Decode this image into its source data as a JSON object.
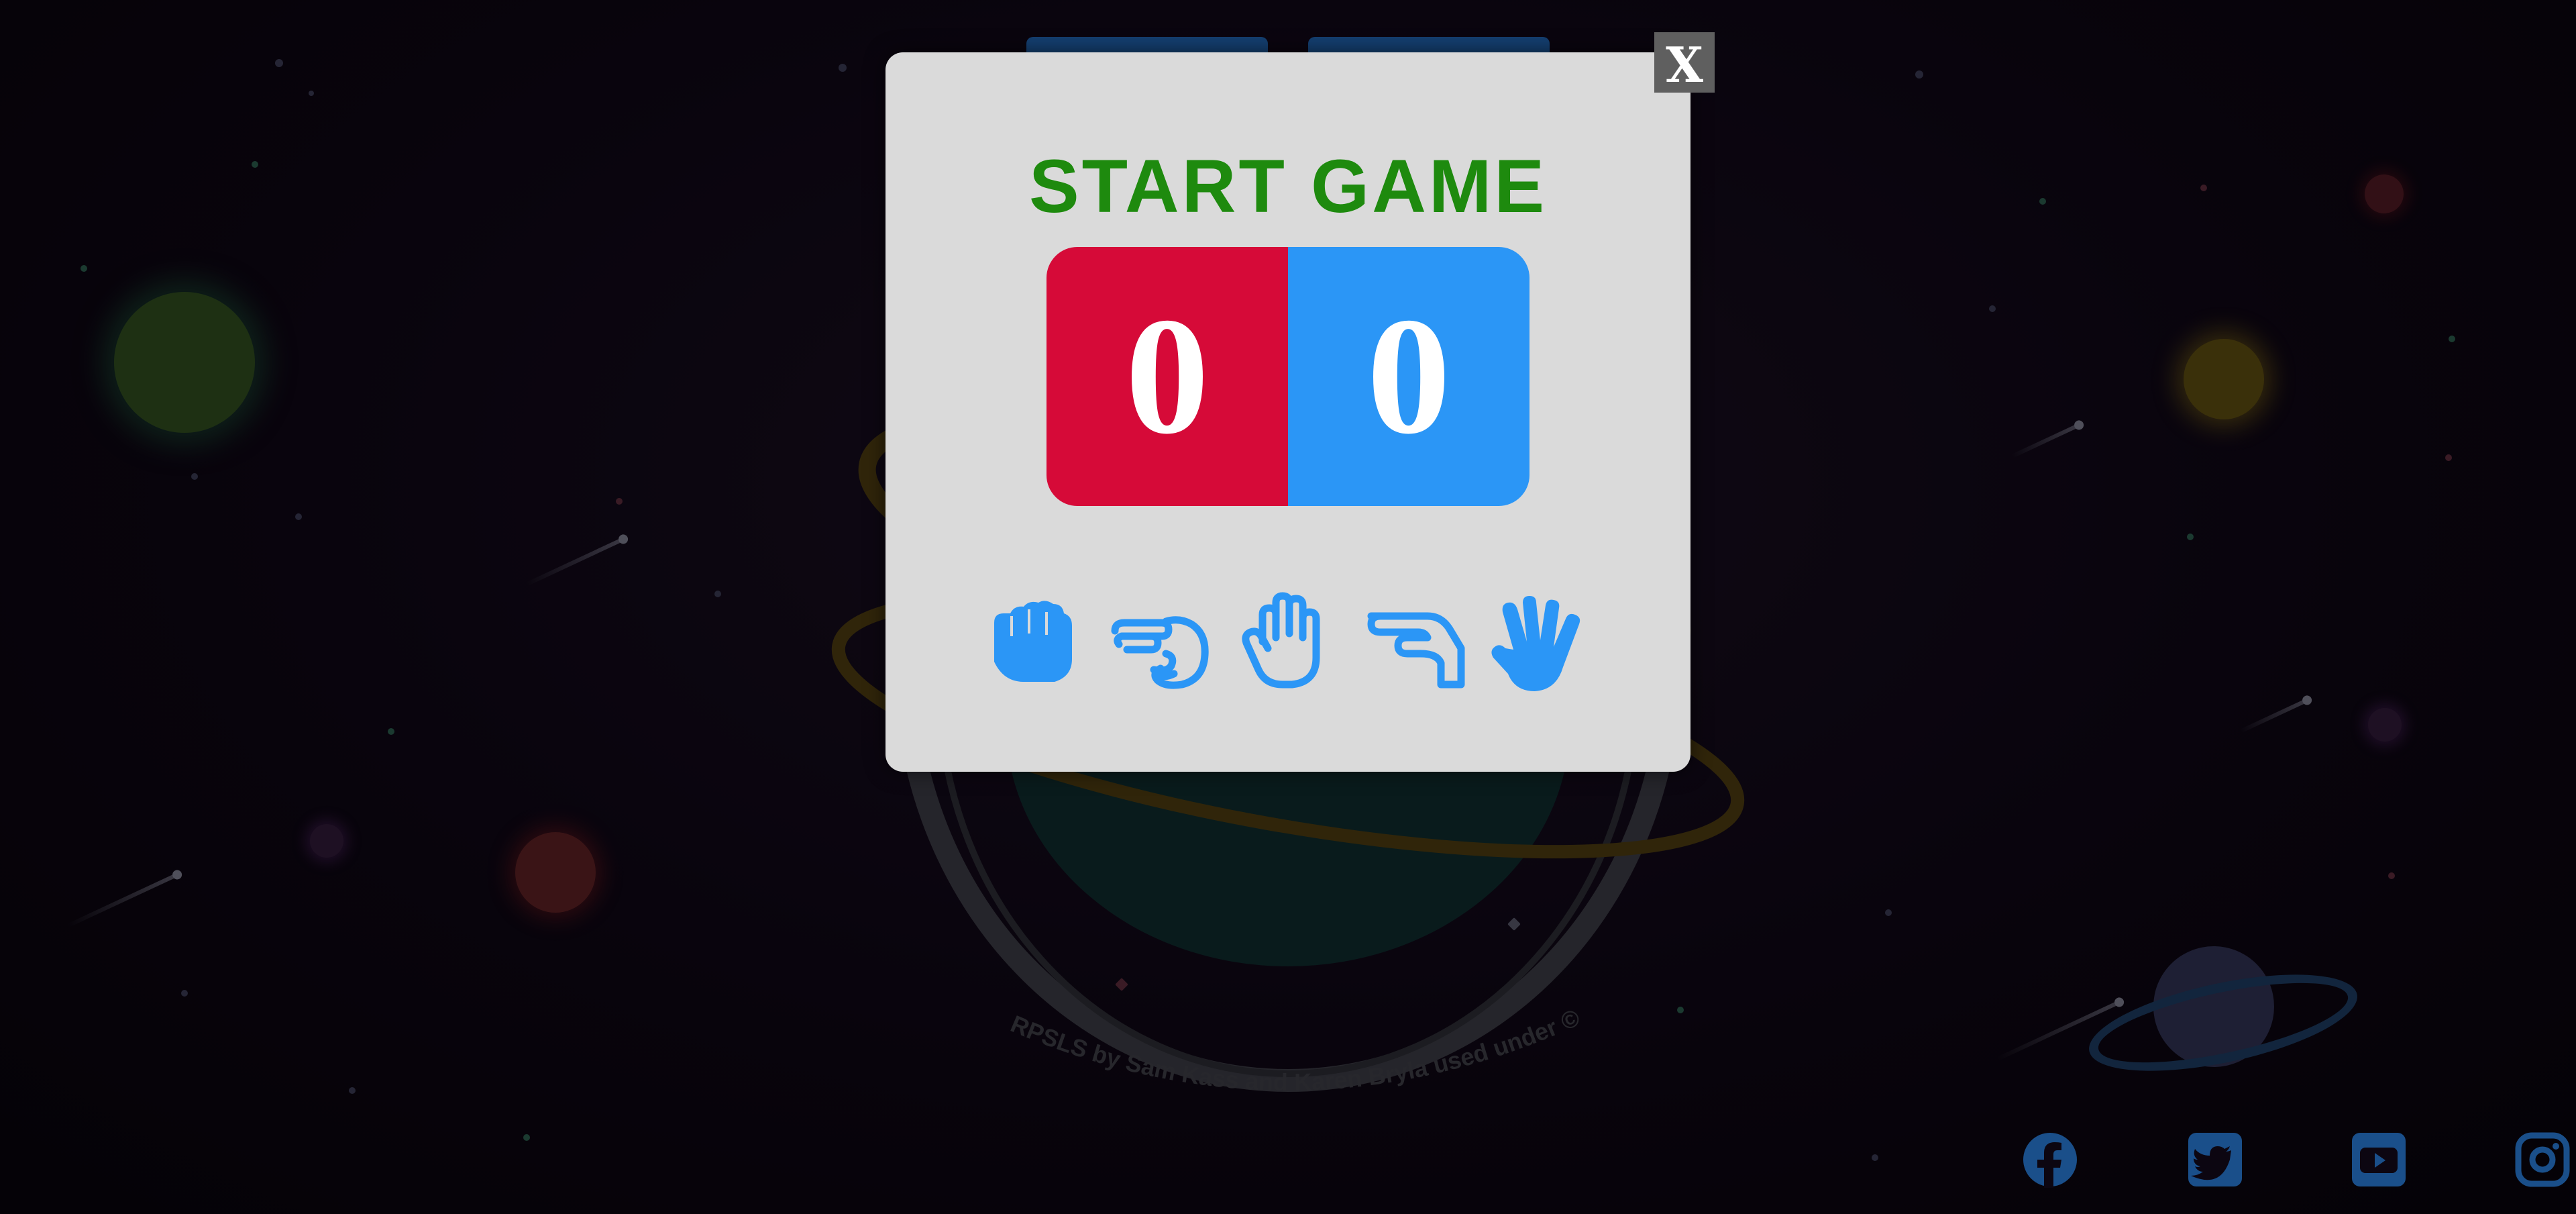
{
  "modal": {
    "title": "START GAME",
    "close_label": "X"
  },
  "score": {
    "player": "0",
    "computer": "0"
  },
  "colors": {
    "title": "#1e8a0e",
    "player_score_bg": "#d60a38",
    "computer_score_bg": "#2b96f6",
    "hand_icons": "#2b96f6",
    "modal_bg": "#dadada"
  },
  "choices": [
    {
      "name": "rock",
      "icon": "fist-icon"
    },
    {
      "name": "scissors",
      "icon": "scissors-hand-icon"
    },
    {
      "name": "paper",
      "icon": "open-hand-icon"
    },
    {
      "name": "lizard",
      "icon": "lizard-hand-icon"
    },
    {
      "name": "spock",
      "icon": "spock-hand-icon"
    }
  ],
  "background": {
    "logo_credit": "RPSLS by Sam Kass and Karen Bryla used under ©"
  },
  "social": [
    {
      "name": "facebook",
      "icon": "facebook-icon"
    },
    {
      "name": "twitter",
      "icon": "twitter-icon"
    },
    {
      "name": "youtube",
      "icon": "youtube-icon"
    },
    {
      "name": "instagram",
      "icon": "instagram-icon"
    }
  ]
}
